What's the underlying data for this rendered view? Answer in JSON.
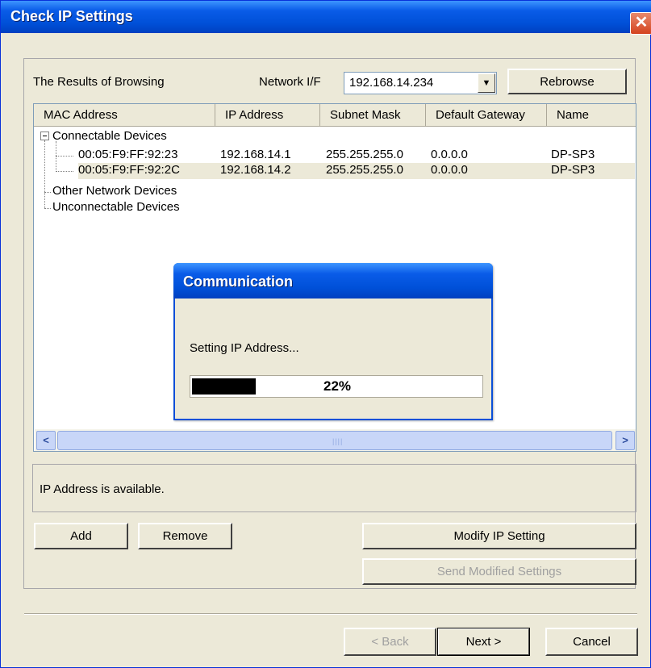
{
  "window": {
    "title": "Check IP Settings",
    "close_glyph": "✕"
  },
  "browse": {
    "label": "The Results of Browsing",
    "network_label": "Network I/F",
    "network_value": "192.168.14.234",
    "rebrowse": "Rebrowse"
  },
  "list": {
    "columns": [
      "MAC Address",
      "IP Address",
      "Subnet Mask",
      "Default Gateway",
      "Name"
    ],
    "group_connectable": "Connectable Devices",
    "rows": [
      {
        "mac": "00:05:F9:FF:92:23",
        "ip": "192.168.14.1",
        "mask": "255.255.255.0",
        "gateway": "0.0.0.0",
        "name": "DP-SP3"
      },
      {
        "mac": "00:05:F9:FF:92:2C",
        "ip": "192.168.14.2",
        "mask": "255.255.255.0",
        "gateway": "0.0.0.0",
        "name": "DP-SP3"
      }
    ],
    "group_other": "Other Network Devices",
    "group_unconnectable": "Unconnectable Devices"
  },
  "status": {
    "text": "IP Address is available."
  },
  "buttons": {
    "add": "Add",
    "remove": "Remove",
    "modify": "Modify IP Setting",
    "send": "Send Modified Settings",
    "back": "< Back",
    "next": "Next >",
    "cancel": "Cancel"
  },
  "dialog": {
    "title": "Communication",
    "message": "Setting IP Address...",
    "progress_percent": 22,
    "progress_label": "22%"
  },
  "colors": {
    "titlebar": "#0050d8",
    "face": "#ece9d8",
    "selection": "#ece9d8"
  }
}
